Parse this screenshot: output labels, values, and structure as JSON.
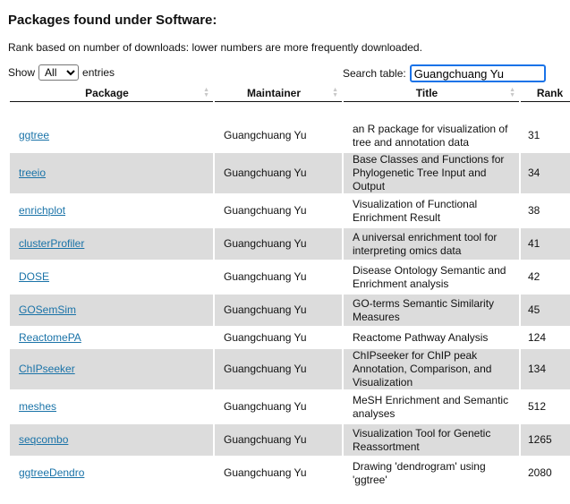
{
  "heading": "Packages found under Software:",
  "rank_note": "Rank based on number of downloads: lower numbers are more frequently downloaded.",
  "show": {
    "label_before": "Show",
    "selected": "All",
    "label_after": "entries"
  },
  "search": {
    "label": "Search table:",
    "value": "Guangchuang Yu"
  },
  "columns": {
    "package": "Package",
    "maintainer": "Maintainer",
    "title": "Title",
    "rank": "Rank"
  },
  "rows": [
    {
      "package": "ggtree",
      "maintainer": "Guangchuang Yu",
      "title": "an R package for visualization of tree and annotation data",
      "rank": "31"
    },
    {
      "package": "treeio",
      "maintainer": "Guangchuang Yu",
      "title": "Base Classes and Functions for Phylogenetic Tree Input and Output",
      "rank": "34"
    },
    {
      "package": "enrichplot",
      "maintainer": "Guangchuang Yu",
      "title": "Visualization of Functional Enrichment Result",
      "rank": "38"
    },
    {
      "package": "clusterProfiler",
      "maintainer": "Guangchuang Yu",
      "title": "A universal enrichment tool for interpreting omics data",
      "rank": "41"
    },
    {
      "package": "DOSE",
      "maintainer": "Guangchuang Yu",
      "title": "Disease Ontology Semantic and Enrichment analysis",
      "rank": "42"
    },
    {
      "package": "GOSemSim",
      "maintainer": "Guangchuang Yu",
      "title": "GO-terms Semantic Similarity Measures",
      "rank": "45"
    },
    {
      "package": "ReactomePA",
      "maintainer": "Guangchuang Yu",
      "title": "Reactome Pathway Analysis",
      "rank": "124"
    },
    {
      "package": "ChIPseeker",
      "maintainer": "Guangchuang Yu",
      "title": "ChIPseeker for ChIP peak Annotation, Comparison, and Visualization",
      "rank": "134"
    },
    {
      "package": "meshes",
      "maintainer": "Guangchuang Yu",
      "title": "MeSH Enrichment and Semantic analyses",
      "rank": "512"
    },
    {
      "package": "seqcombo",
      "maintainer": "Guangchuang Yu",
      "title": "Visualization Tool for Genetic Reassortment",
      "rank": "1265"
    },
    {
      "package": "ggtreeDendro",
      "maintainer": "Guangchuang Yu",
      "title": "Drawing 'dendrogram' using 'ggtree'",
      "rank": "2080"
    }
  ]
}
